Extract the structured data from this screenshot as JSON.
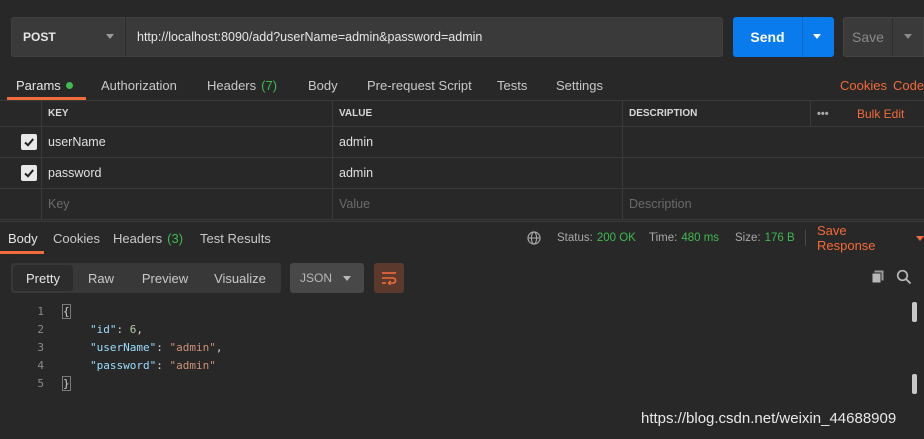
{
  "request": {
    "method": "POST",
    "url": "http://localhost:8090/add?userName=admin&password=admin",
    "send_label": "Send",
    "save_label": "Save"
  },
  "request_tabs": {
    "params": "Params",
    "authorization": "Authorization",
    "headers": "Headers",
    "headers_count": "(7)",
    "body": "Body",
    "prerequest": "Pre-request Script",
    "tests": "Tests",
    "settings": "Settings",
    "cookies": "Cookies",
    "code": "Code"
  },
  "params_table": {
    "columns": {
      "key": "KEY",
      "value": "VALUE",
      "description": "DESCRIPTION"
    },
    "more": "•••",
    "bulk_edit": "Bulk Edit",
    "rows": [
      {
        "checked": true,
        "key": "userName",
        "value": "admin",
        "description": ""
      },
      {
        "checked": true,
        "key": "password",
        "value": "admin",
        "description": ""
      }
    ],
    "placeholders": {
      "key": "Key",
      "value": "Value",
      "description": "Description"
    }
  },
  "response_tabs": {
    "body": "Body",
    "cookies": "Cookies",
    "headers": "Headers",
    "headers_count": "(3)",
    "test_results": "Test Results"
  },
  "response_status": {
    "status_label": "Status:",
    "status_value": "200 OK",
    "time_label": "Time:",
    "time_value": "480 ms",
    "size_label": "Size:",
    "size_value": "176 B",
    "save_response": "Save Response"
  },
  "response_view": {
    "modes": [
      "Pretty",
      "Raw",
      "Preview",
      "Visualize"
    ],
    "format": "JSON"
  },
  "response_body_lines": [
    "1",
    "2",
    "3",
    "4",
    "5"
  ],
  "response_body": {
    "open_brace": "{",
    "close_brace": "}",
    "fields": [
      {
        "key": "\"id\"",
        "value": "6",
        "type": "number",
        "comma": ","
      },
      {
        "key": "\"userName\"",
        "value": "\"admin\"",
        "type": "string",
        "comma": ","
      },
      {
        "key": "\"password\"",
        "value": "\"admin\"",
        "type": "string",
        "comma": ""
      }
    ]
  },
  "watermark": "https://blog.csdn.net/weixin_44688909",
  "colors": {
    "accent": "#f26b3a",
    "send": "#097bed",
    "success": "#3fb950"
  },
  "icons": [
    "chevron-down-icon",
    "checkmark-icon",
    "globe-icon",
    "wrap-lines-icon",
    "copy-icon",
    "search-icon"
  ]
}
